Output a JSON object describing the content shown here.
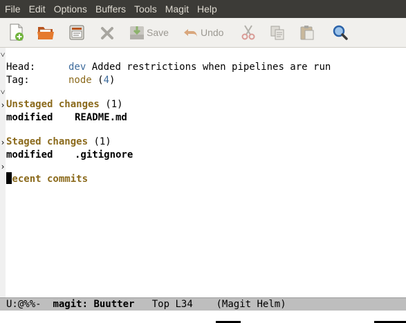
{
  "menubar": {
    "items": [
      "File",
      "Edit",
      "Options",
      "Buffers",
      "Tools",
      "Magit",
      "Help"
    ]
  },
  "toolbar": {
    "save_label": "Save",
    "undo_label": "Undo",
    "icons": [
      "new-file-icon",
      "open-folder-icon",
      "dired-icon",
      "close-icon",
      "save-icon",
      "undo-icon",
      "cut-icon",
      "copy-icon",
      "paste-icon",
      "search-icon"
    ]
  },
  "status": {
    "head_key": "Head:",
    "head_branch": "dev",
    "head_message": "Added restrictions when pipelines are run",
    "tag_key": "Tag:",
    "tag_name": "node",
    "tag_open": "(",
    "tag_distance": "4",
    "tag_close": ")"
  },
  "sections": {
    "unstaged": {
      "title": "Unstaged changes",
      "count": "(1)",
      "files": [
        {
          "status": "modified",
          "name": "README.md"
        }
      ]
    },
    "staged": {
      "title": "Staged changes",
      "count": "(1)",
      "files": [
        {
          "status": "modified",
          "name": ".gitignore"
        }
      ]
    },
    "recent": {
      "title": "Recent commits"
    }
  },
  "fringe": {
    "expanded": "˅",
    "collapsed": "›"
  },
  "modeline": {
    "state": "U:@%%-",
    "buffer": "magit: Buutter",
    "position": "Top L34",
    "modes": "(Magit Helm)"
  },
  "colors": {
    "menubar_bg": "#3c3b37",
    "toolbar_bg": "#f1f0ed",
    "section_heading": "#8b6a1c",
    "branch": "#3d6b9c",
    "modeline_bg": "#bebebe"
  }
}
